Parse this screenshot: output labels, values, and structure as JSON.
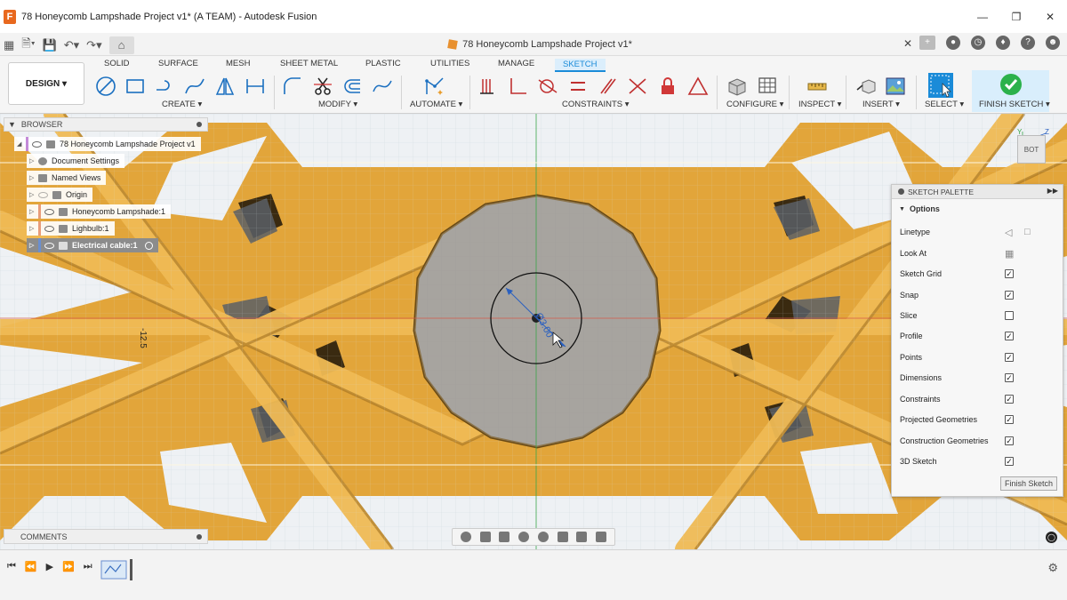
{
  "window": {
    "title": "78 Honeycomb Lampshade Project v1* (A TEAM) - Autodesk Fusion",
    "logo": "F"
  },
  "document": {
    "tab_title": "78 Honeycomb Lampshade Project v1*"
  },
  "ribbon": {
    "workspace": "DESIGN",
    "tabs": [
      "SOLID",
      "SURFACE",
      "MESH",
      "SHEET METAL",
      "PLASTIC",
      "UTILITIES",
      "MANAGE",
      "SKETCH"
    ],
    "active_tab": "SKETCH",
    "groups": {
      "create": "CREATE",
      "modify": "MODIFY",
      "automate": "AUTOMATE",
      "constraints": "CONSTRAINTS",
      "configure": "CONFIGURE",
      "inspect": "INSPECT",
      "insert": "INSERT",
      "select": "SELECT",
      "finish_sketch": "FINISH SKETCH"
    }
  },
  "browser": {
    "title": "BROWSER",
    "root": "78 Honeycomb Lampshade Project v1",
    "items": [
      {
        "label": "Document Settings"
      },
      {
        "label": "Named Views"
      },
      {
        "label": "Origin"
      },
      {
        "label": "Honeycomb Lampshade:1",
        "color": "#e89c7a"
      },
      {
        "label": "Lighbulb:1",
        "color": "#e89c7a"
      },
      {
        "label": "Electrical cable:1",
        "color": "#6a8fd0"
      }
    ]
  },
  "comments": {
    "title": "COMMENTS"
  },
  "sketch_palette": {
    "title": "SKETCH PALETTE",
    "section": "Options",
    "options": [
      {
        "label": "Linetype",
        "type": "icons"
      },
      {
        "label": "Look At",
        "type": "icon"
      },
      {
        "label": "Sketch Grid",
        "checked": true
      },
      {
        "label": "Snap",
        "checked": true
      },
      {
        "label": "Slice",
        "checked": false
      },
      {
        "label": "Profile",
        "checked": true
      },
      {
        "label": "Points",
        "checked": true
      },
      {
        "label": "Dimensions",
        "checked": true
      },
      {
        "label": "Constraints",
        "checked": true
      },
      {
        "label": "Projected Geometries",
        "checked": true
      },
      {
        "label": "Construction Geometries",
        "checked": true
      },
      {
        "label": "3D Sketch",
        "checked": true
      }
    ],
    "finish_label": "Finish Sketch"
  },
  "viewport": {
    "dimension_value": "-12.5",
    "diameter_label": "Ø3.00",
    "viewcube_label": "BOT",
    "axis_z": "Z",
    "axis_y": "Y"
  },
  "colors": {
    "accent": "#1a8bd8",
    "honeycomb": "#e5a93a",
    "finish_green": "#2bb14b"
  }
}
